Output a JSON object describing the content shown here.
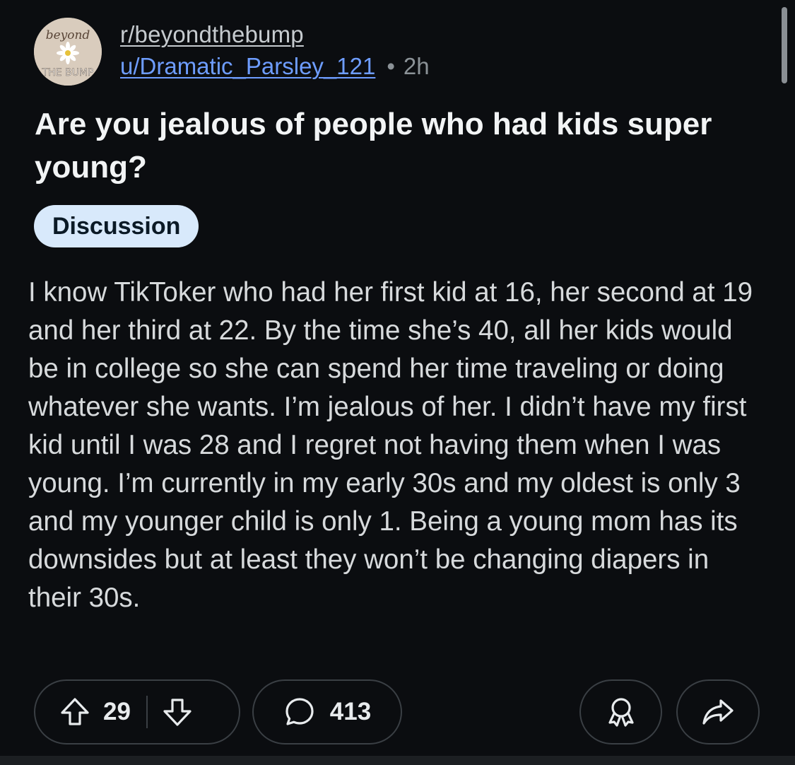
{
  "post": {
    "subreddit": "r/beyondthebump",
    "subreddit_icon_text_top": "beyond",
    "subreddit_icon_text_bottom": "THE BUMP",
    "author": "u/Dramatic_Parsley_121",
    "separator": "•",
    "age": "2h",
    "title": "Are you jealous of people who had kids super young?",
    "flair": "Discussion",
    "body": "I know TikToker who had her first kid at 16, her second at 19 and her third at 22. By the time she’s 40, all her kids would be in college so she can spend her time traveling or doing whatever she wants. I’m jealous of her. I didn’t have my first kid until I was 28 and I regret not having them when I was young. I’m currently in my early 30s and my oldest is only 3 and my younger child is only 1. Being a young mom has its downsides but at least they won’t be changing diapers in their 30s."
  },
  "actions": {
    "upvote_icon": "upvote-arrow-icon",
    "score": "29",
    "downvote_icon": "downvote-arrow-icon",
    "comment_icon": "comment-bubble-icon",
    "comments": "413",
    "award_icon": "award-icon",
    "share_icon": "share-arrow-icon"
  },
  "colors": {
    "background": "#0b0d10",
    "link_blue": "#6e9dff",
    "flair_bg": "#d8e9fb",
    "pill_border": "#3a3f44"
  }
}
